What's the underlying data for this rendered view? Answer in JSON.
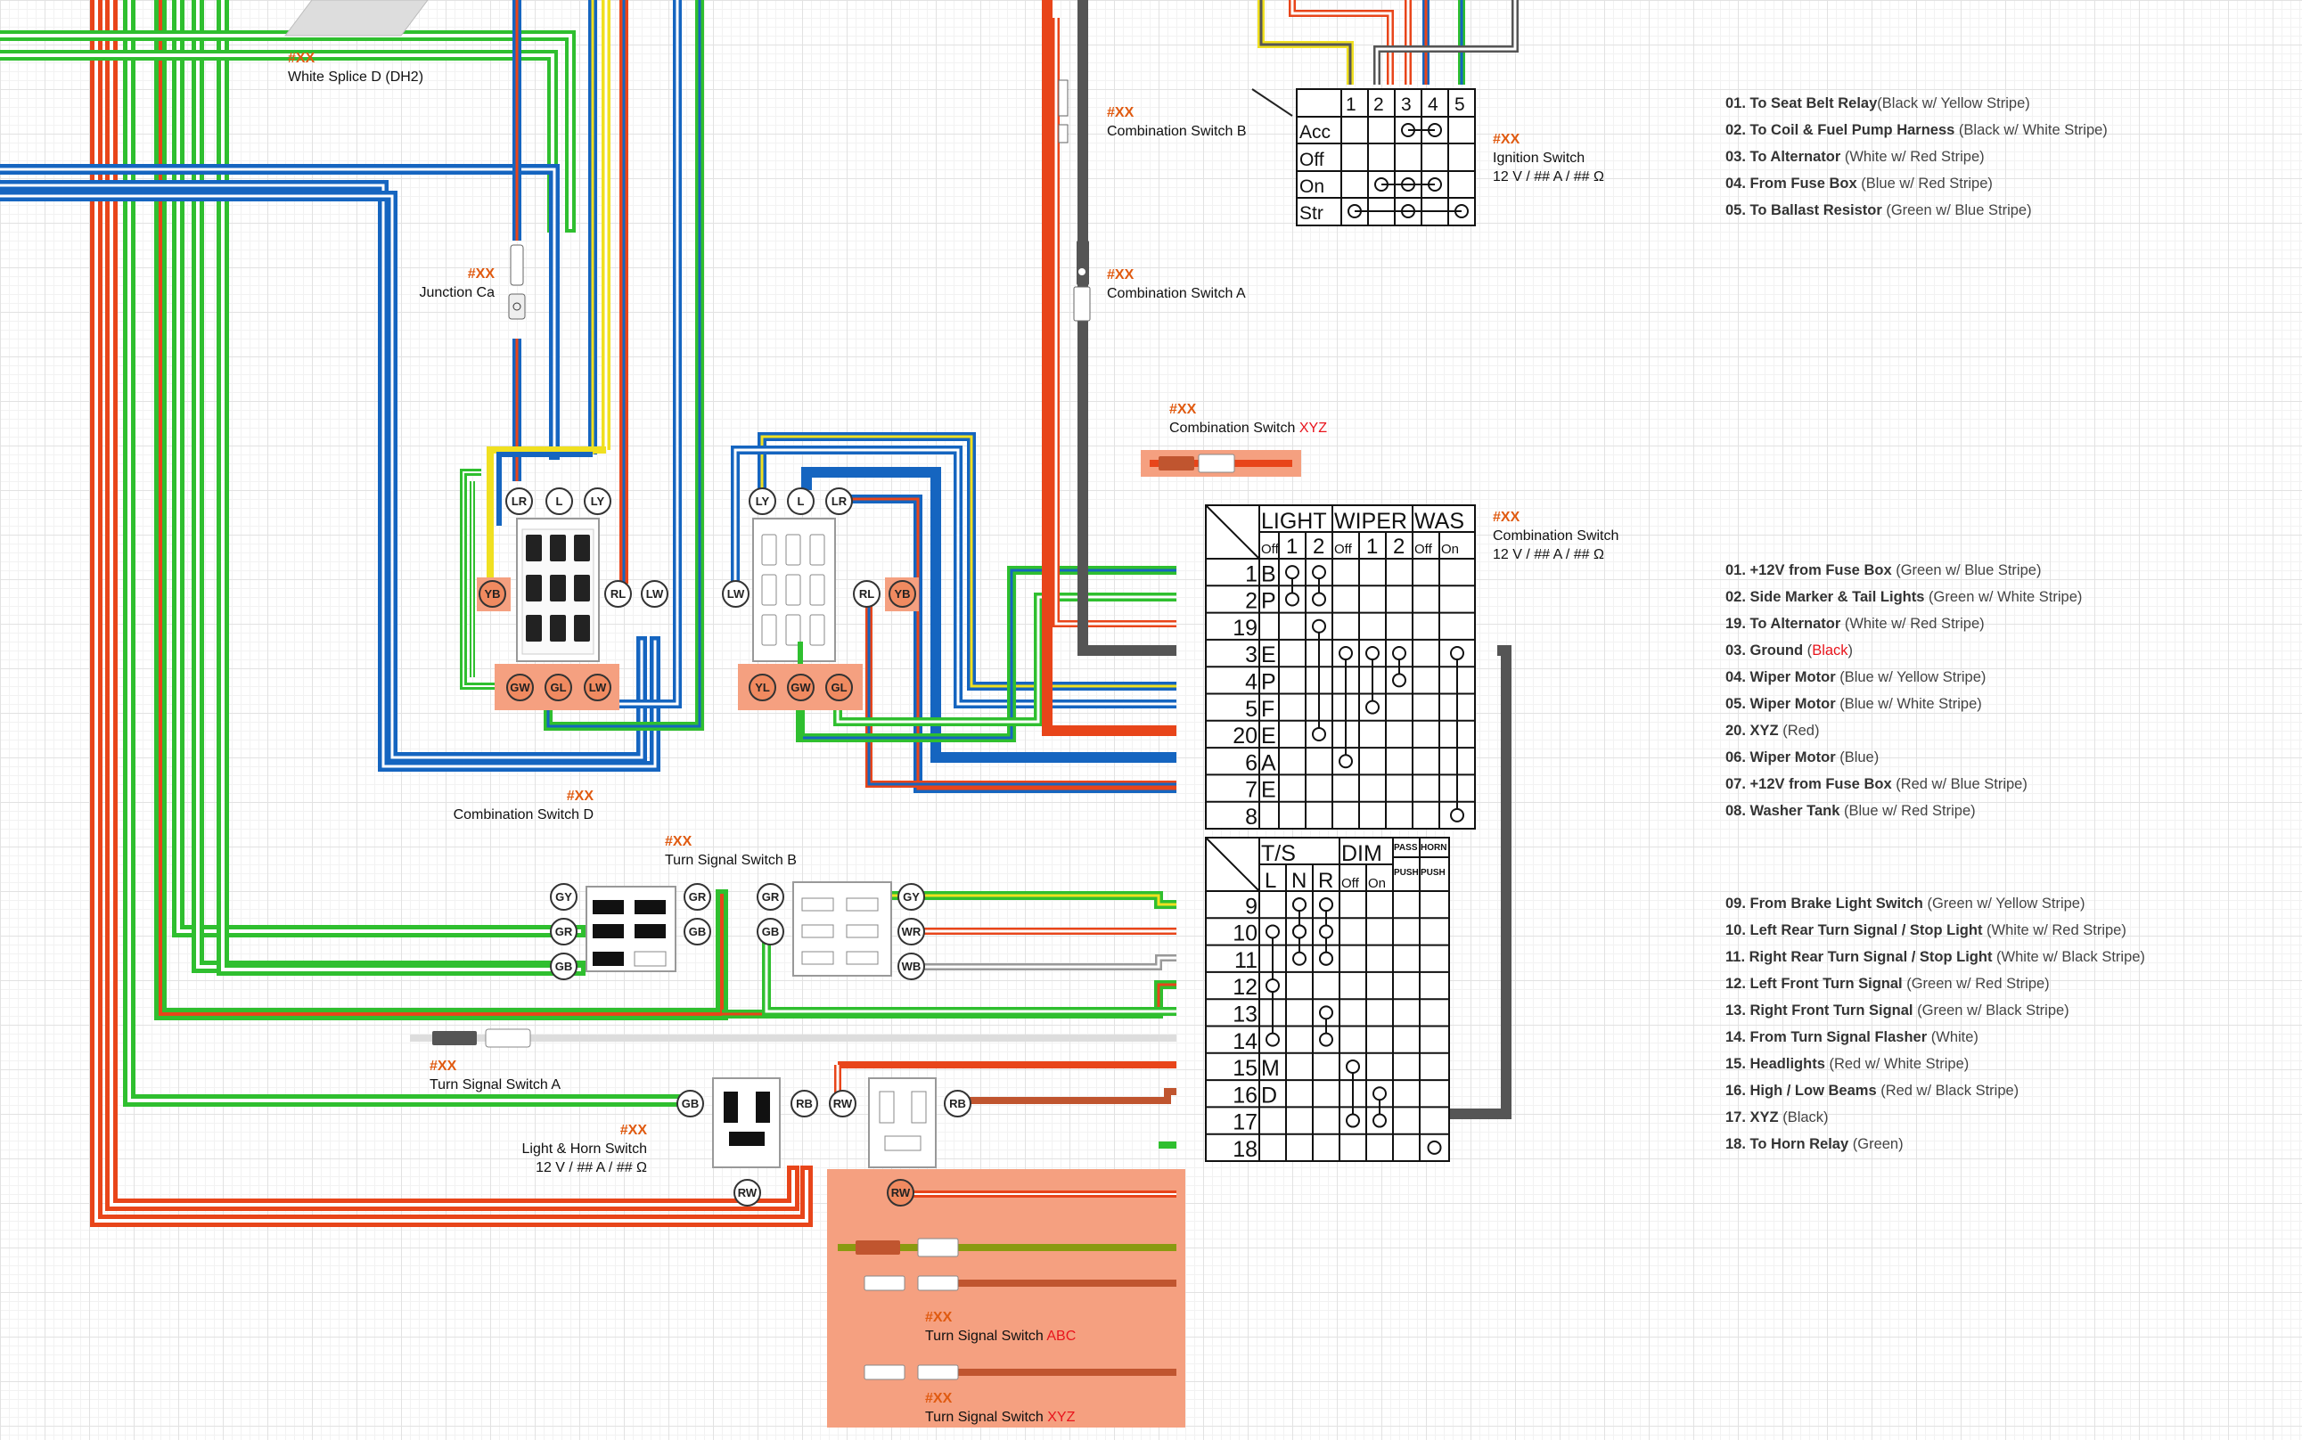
{
  "placeholder_code": "#XX",
  "rating": "12 V / ## A / ## Ω",
  "components": {
    "white_splice": "White Splice D (DH2)",
    "junction": "Junction Ca",
    "combo_switch_b": "Combination Switch B",
    "combo_switch_a": "Combination Switch A",
    "combo_switch_xyz_prefix": "Combination Switch ",
    "combo_switch_xyz_suffix": "XYZ",
    "ignition_switch": "Ignition Switch",
    "combo_switch": "Combination Switch",
    "combo_switch_d": "Combination Switch D",
    "turn_signal_b": "Turn Signal Switch B",
    "turn_signal_a": "Turn Signal Switch A",
    "light_horn": "Light & Horn Switch",
    "turn_abc_prefix": "Turn Signal Switch ",
    "turn_abc_suffix": "ABC",
    "turn_xyz_prefix": "Turn Signal Switch ",
    "turn_xyz_suffix": "XYZ"
  },
  "ignition_table": {
    "columns": [
      "1",
      "2",
      "3",
      "4",
      "5"
    ],
    "rows": [
      "Acc",
      "Off",
      "On",
      "Str"
    ]
  },
  "combo_table": {
    "groups": [
      "LIGHT",
      "WIPER",
      "WAS"
    ],
    "subheaders": [
      "Off",
      "1",
      "2",
      "Off",
      "1",
      "2",
      "Off",
      "On"
    ],
    "rows": [
      {
        "num": "1",
        "letter": "B"
      },
      {
        "num": "2",
        "letter": "P"
      },
      {
        "num": "19",
        "letter": ""
      },
      {
        "num": "3",
        "letter": "E"
      },
      {
        "num": "4",
        "letter": "P"
      },
      {
        "num": "5",
        "letter": "F"
      },
      {
        "num": "20",
        "letter": "E"
      },
      {
        "num": "6",
        "letter": "A"
      },
      {
        "num": "7",
        "letter": "E"
      },
      {
        "num": "8",
        "letter": ""
      }
    ]
  },
  "ts_table": {
    "groups": [
      "T/S",
      "DIM",
      "PASS",
      "HORN"
    ],
    "subheaders": [
      "L",
      "N",
      "R",
      "Off",
      "On",
      "PUSH",
      "PUSH"
    ],
    "rows": [
      {
        "num": "9",
        "letter": ""
      },
      {
        "num": "10",
        "letter": ""
      },
      {
        "num": "11",
        "letter": ""
      },
      {
        "num": "12",
        "letter": ""
      },
      {
        "num": "13",
        "letter": ""
      },
      {
        "num": "14",
        "letter": ""
      },
      {
        "num": "15",
        "letter": "M"
      },
      {
        "num": "16",
        "letter": "D"
      },
      {
        "num": "17",
        "letter": ""
      },
      {
        "num": "18",
        "letter": ""
      }
    ]
  },
  "connector_pins": {
    "d_top": [
      "LR",
      "L",
      "LY"
    ],
    "d_yb": "YB",
    "d_rl": "RL",
    "d_lw": "LW",
    "d_bottom": [
      "GW",
      "GL",
      "LW"
    ],
    "d2_top": [
      "LY",
      "L",
      "LR"
    ],
    "d2_lw": "LW",
    "d2_rl": "RL",
    "d2_yb": "YB",
    "d2_bottom": [
      "YL",
      "GW",
      "GL"
    ],
    "tsb_left": [
      "GY",
      "GR",
      "GB"
    ],
    "tsb_right": [
      "GR",
      "GB"
    ],
    "tsb2_left": [
      "GR",
      "GB"
    ],
    "tsb2_right": [
      "GY",
      "WR",
      "WB"
    ],
    "lh_gb": "GB",
    "lh_rb": "RB",
    "lh_rw": "RW",
    "rw": "RW",
    "rb": "RB",
    "rw2": "RW"
  },
  "legend_ignition": [
    {
      "num": "01.",
      "name": "To Seat Belt Relay",
      "desc": "(Black w/ Yellow Stripe)"
    },
    {
      "num": "02.",
      "name": "To Coil & Fuel Pump Harness",
      "desc": " (Black w/ White Stripe)"
    },
    {
      "num": "03.",
      "name": "To Alternator",
      "desc": " (White w/ Red Stripe)"
    },
    {
      "num": "04.",
      "name": "From Fuse Box",
      "desc": " (Blue w/ Red Stripe)"
    },
    {
      "num": "05.",
      "name": "To Ballast Resistor",
      "desc": " (Green w/ Blue Stripe)"
    }
  ],
  "legend_combo": [
    {
      "lead": "01. +12V from Fuse Box",
      "tail": " (Green w/ Blue Stripe)"
    },
    {
      "lead": "02. Side Marker & Tail Lights",
      "tail": " (Green w/ White Stripe)"
    },
    {
      "lead": "19. ",
      "red": "To Alternator",
      "tail": " (White w/ Red Stripe)"
    },
    {
      "lead": "03. Ground",
      "tail_pre": " (",
      "red_tail": "Black",
      "tail": ")"
    },
    {
      "lead": "04. Wiper Motor",
      "tail": " (Blue w/ Yellow Stripe)"
    },
    {
      "lead": "05. Wiper Motor",
      "tail": " (Blue w/ White Stripe)"
    },
    {
      "lead": "20. ",
      "red": "XYZ",
      "tail": " (Red)"
    },
    {
      "lead": "06. Wiper Motor",
      "tail": " (Blue)"
    },
    {
      "lead": "07. +12V from Fuse Box",
      "tail": " (Red w/ Blue Stripe)"
    },
    {
      "lead": "08. Washer Tank",
      "tail": " (Blue w/ Red Stripe)"
    }
  ],
  "legend_ts": [
    {
      "lead": "09. From Brake Light Switch",
      "tail": " (Green w/ Yellow Stripe)"
    },
    {
      "lead": "10. Left Rear Turn Signal / Stop Light",
      "tail": " (White w/ Red Stripe)"
    },
    {
      "lead": "11. Right Rear Turn Signal / Stop Light",
      "tail": " (White w/ Black Stripe)"
    },
    {
      "lead": "12. Left Front Turn Signal",
      "tail": " (Green w/ Red Stripe)"
    },
    {
      "lead": "13. Right Front Turn Signal",
      "tail": " (Green w/ Black Stripe)"
    },
    {
      "lead": "14. From Turn Signal Flasher",
      "tail": " (White)"
    },
    {
      "lead": "15. Headlights",
      "tail": " (Red w/ White Stripe)"
    },
    {
      "lead": "16. High / Low Beams",
      "tail": " (Red w/ Black Stripe)"
    },
    {
      "lead": "17. ",
      "red": "XYZ",
      "tail": " (Black)"
    },
    {
      "lead": "18. ",
      "red": "To Horn Relay",
      "tail": " (Green)"
    }
  ],
  "colors": {
    "green": "#2fbf2f",
    "blue": "#1565c0",
    "red": "#e8451a",
    "yellow": "#f0e020",
    "black": "#555555",
    "white_edge": "#999999",
    "highlight": "#f5a080",
    "accent": "#e05a10"
  }
}
